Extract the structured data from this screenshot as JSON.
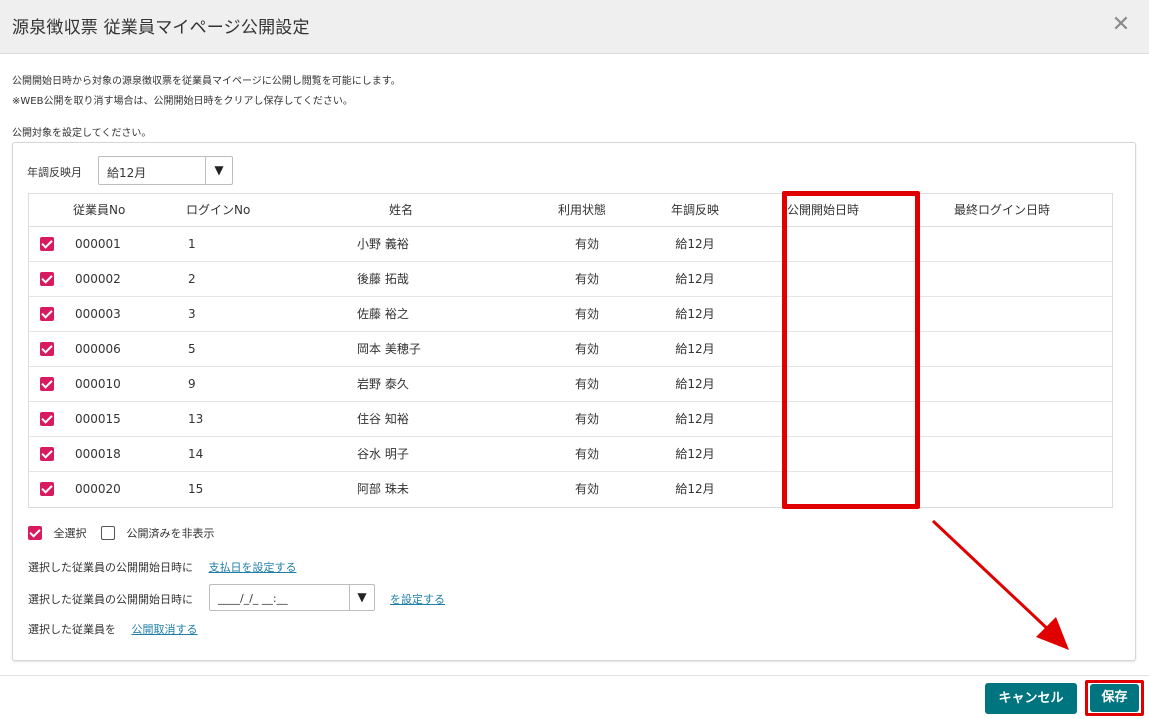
{
  "dialog": {
    "title": "源泉徴収票 従業員マイページ公開設定",
    "close_icon": "close-icon"
  },
  "description": {
    "line1": "公開開始日時から対象の源泉徴収票を従業員マイページに公開し閲覧を可能にします。",
    "line2": "※WEB公開を取り消す場合は、公開開始日時をクリアし保存してください。",
    "line3": "公開対象を設定してください。"
  },
  "filter": {
    "month_label": "年調反映月",
    "month_value": "給12月",
    "dropdown_icon": "caret-down-icon"
  },
  "table": {
    "columns": [
      "従業員No",
      "ログインNo",
      "姓名",
      "利用状態",
      "年調反映",
      "公開開始日時",
      "最終ログイン日時"
    ],
    "rows": [
      {
        "checked": true,
        "emp_no": "000001",
        "login_no": "1",
        "name": "小野 義裕",
        "status": "有効",
        "reflect": "給12月",
        "open_at": "",
        "last_login": ""
      },
      {
        "checked": true,
        "emp_no": "000002",
        "login_no": "2",
        "name": "後藤 拓哉",
        "status": "有効",
        "reflect": "給12月",
        "open_at": "",
        "last_login": ""
      },
      {
        "checked": true,
        "emp_no": "000003",
        "login_no": "3",
        "name": "佐藤 裕之",
        "status": "有効",
        "reflect": "給12月",
        "open_at": "",
        "last_login": ""
      },
      {
        "checked": true,
        "emp_no": "000006",
        "login_no": "5",
        "name": "岡本 美穂子",
        "status": "有効",
        "reflect": "給12月",
        "open_at": "",
        "last_login": ""
      },
      {
        "checked": true,
        "emp_no": "000010",
        "login_no": "9",
        "name": "岩野 泰久",
        "status": "有効",
        "reflect": "給12月",
        "open_at": "",
        "last_login": ""
      },
      {
        "checked": true,
        "emp_no": "000015",
        "login_no": "13",
        "name": "住谷 知裕",
        "status": "有効",
        "reflect": "給12月",
        "open_at": "",
        "last_login": ""
      },
      {
        "checked": true,
        "emp_no": "000018",
        "login_no": "14",
        "name": "谷水 明子",
        "status": "有効",
        "reflect": "給12月",
        "open_at": "",
        "last_login": ""
      },
      {
        "checked": true,
        "emp_no": "000020",
        "login_no": "15",
        "name": "阿部 珠未",
        "status": "有効",
        "reflect": "給12月",
        "open_at": "",
        "last_login": ""
      }
    ]
  },
  "options": {
    "select_all": "全選択",
    "hide_published": "公開済みを非表示"
  },
  "actions": {
    "paydate_prefix": "選択した従業員の公開開始日時に",
    "paydate_link": "支払日を設定する",
    "datetime_prefix": "選択した従業員の公開開始日時に",
    "datetime_value": "____/_/_ __:__",
    "datetime_link": "を設定する",
    "cancel_prefix": "選択した従業員を",
    "cancel_link": "公開取消する"
  },
  "footer": {
    "cancel_label": "キャンセル",
    "save_label": "保存"
  },
  "colors": {
    "checkbox": "#d81b60",
    "button": "#00747f",
    "annotation": "#e00000",
    "link": "#1f7fa8"
  }
}
